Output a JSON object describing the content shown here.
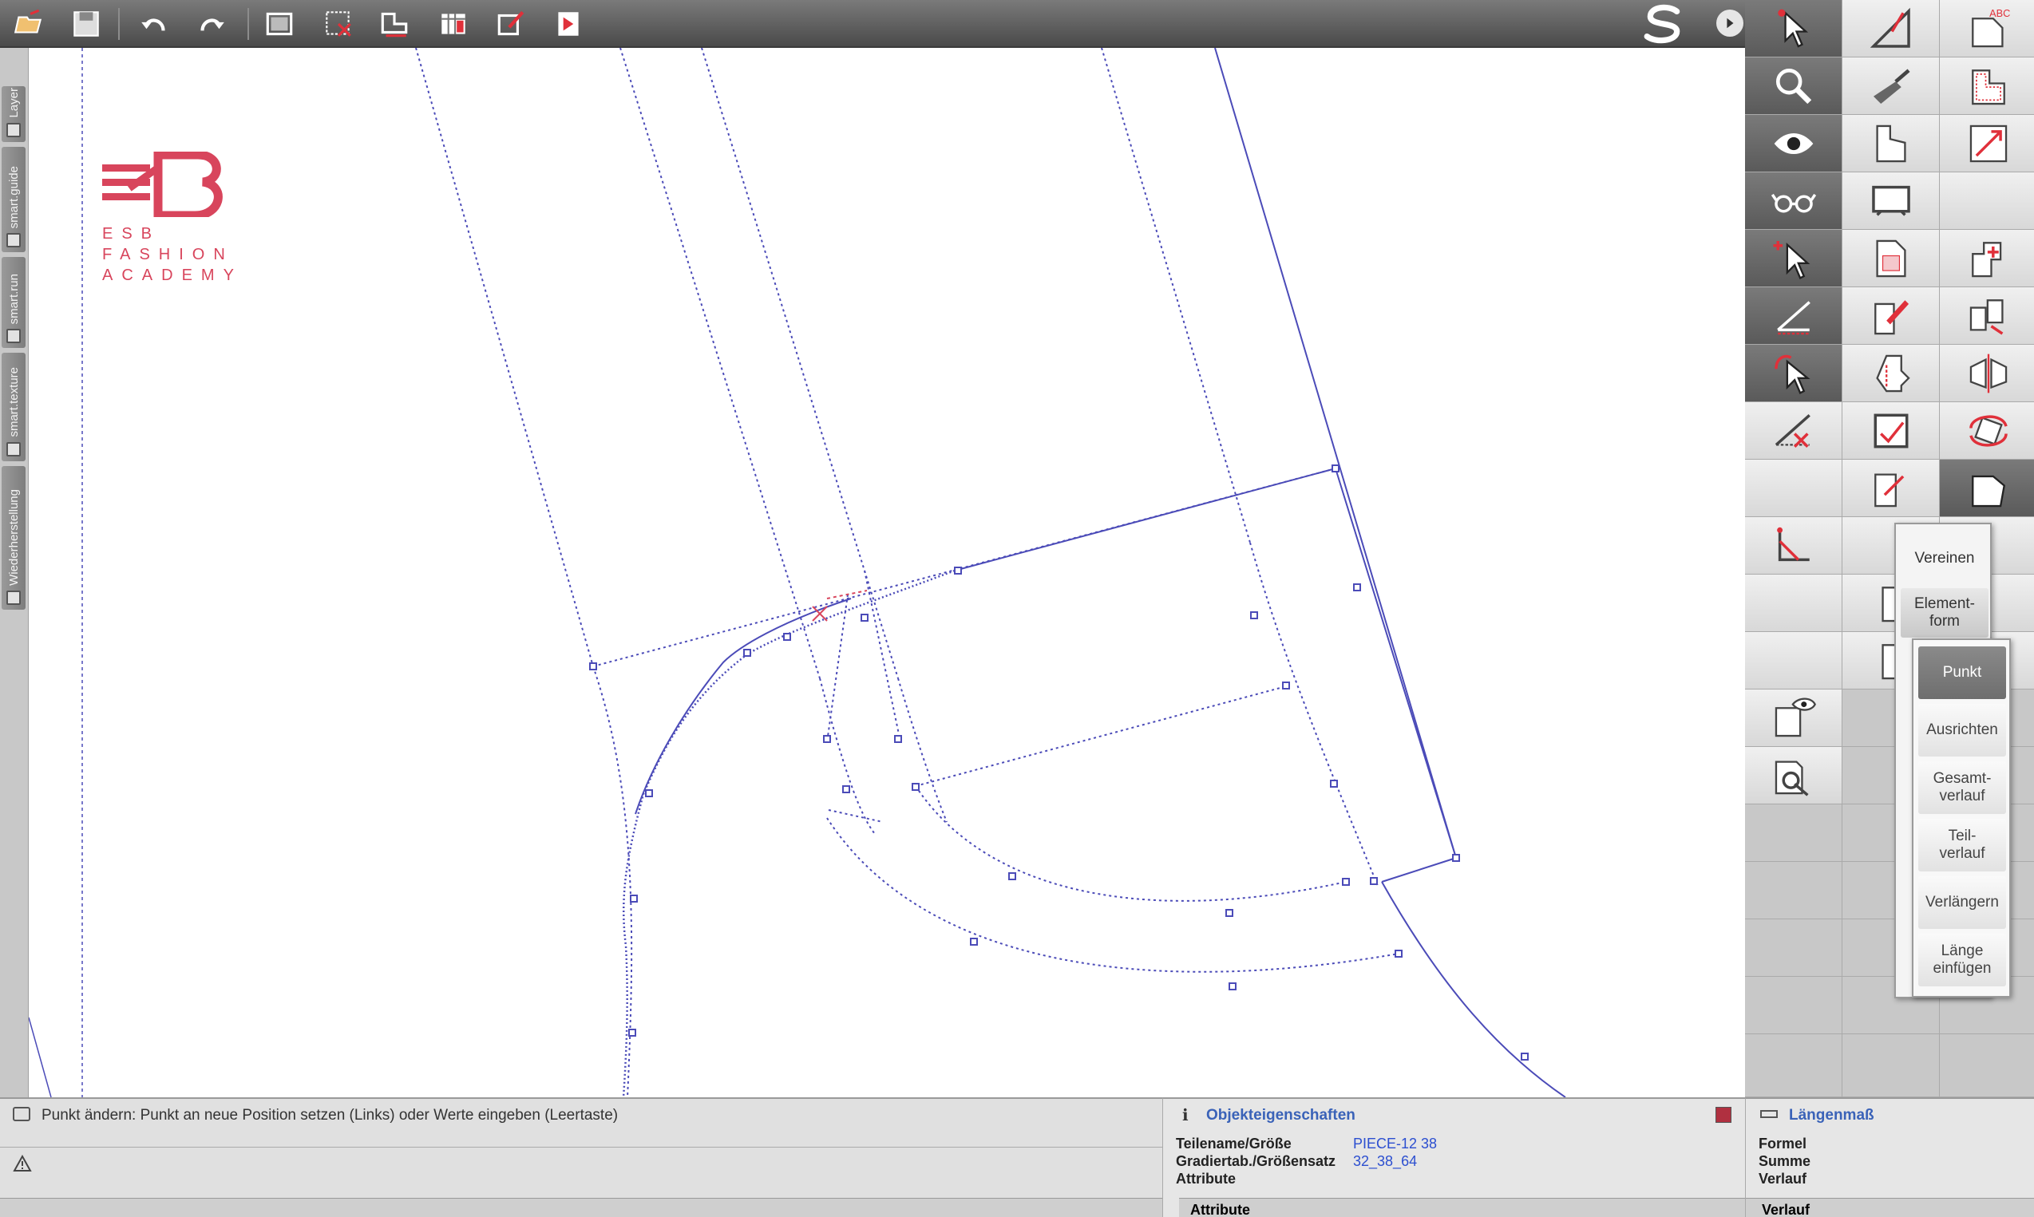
{
  "logo": {
    "line1": "ESB",
    "line2": "FASHION",
    "line3": "ACADEMY"
  },
  "left_tabs": [
    {
      "label": "Layer",
      "icon": "layer-icon"
    },
    {
      "label": "smart.guide",
      "icon": "guide-icon"
    },
    {
      "label": "smart.run",
      "icon": "run-icon"
    },
    {
      "label": "smart.texture",
      "icon": "texture-icon"
    },
    {
      "label": "Wiederherstellung",
      "icon": "restore-icon"
    }
  ],
  "toolbar": {
    "buttons": [
      "open-icon",
      "save-icon",
      "undo-icon",
      "redo-icon",
      "plotter-icon",
      "delete-piece-icon",
      "grading-icon",
      "table-icon",
      "edit-piece-icon",
      "send-icon"
    ]
  },
  "element_form_menu": {
    "items": [
      "Vereinen",
      "Element-\nform"
    ]
  },
  "point_submenu": {
    "items": [
      "Punkt",
      "Ausrichten",
      "Gesamt-\nverlauf",
      "Teil-\nverlauf",
      "Verlängern",
      "Länge\neinfügen"
    ],
    "selected": "Punkt"
  },
  "status": {
    "message": "Punkt ändern: Punkt an neue Position setzen (Links) oder Werte eingeben (Leertaste)"
  },
  "properties": {
    "title": "Objekteigenschaften",
    "rows": [
      {
        "label": "Teilename/Größe",
        "value": "PIECE-12 38"
      },
      {
        "label": "Gradiertab./Größensatz",
        "value": "32_38_64"
      },
      {
        "label": "Attribute",
        "value": ""
      }
    ],
    "footer": "Attribute"
  },
  "measure": {
    "title": "Längenmaß",
    "rows": [
      "Formel",
      "Summe",
      "Verlauf"
    ],
    "footer": "Verlauf"
  },
  "colors": {
    "pattern_line": "#4b4bb8",
    "brand": "#d8455c",
    "link_value": "#2c4fd0"
  }
}
